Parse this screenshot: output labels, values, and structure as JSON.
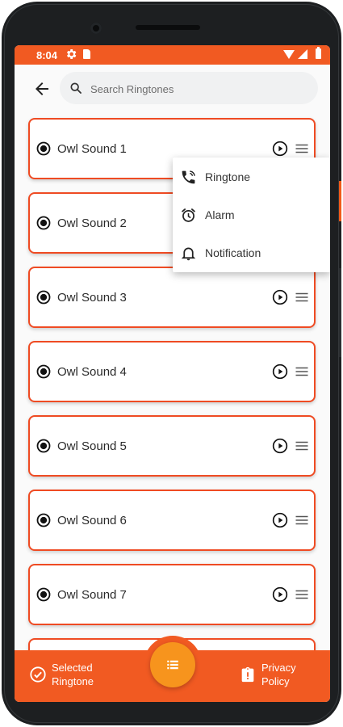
{
  "status_bar": {
    "time": "8:04",
    "icons": [
      "gear-icon",
      "sd-card-icon",
      "wifi-icon",
      "cell-signal-icon",
      "battery-icon"
    ]
  },
  "search": {
    "placeholder": "Search Ringtones",
    "value": ""
  },
  "ringtones": [
    {
      "label": "Owl Sound 1"
    },
    {
      "label": "Owl Sound 2"
    },
    {
      "label": "Owl Sound 3"
    },
    {
      "label": "Owl Sound 4"
    },
    {
      "label": "Owl Sound 5"
    },
    {
      "label": "Owl Sound 6"
    },
    {
      "label": "Owl Sound 7"
    }
  ],
  "popup_menu": {
    "items": [
      {
        "label": "Ringtone",
        "icon": "phone-ring-icon"
      },
      {
        "label": "Alarm",
        "icon": "alarm-clock-icon"
      },
      {
        "label": "Notification",
        "icon": "bell-icon"
      }
    ]
  },
  "bottom_bar": {
    "selected_label_line1": "Selected",
    "selected_label_line2": "Ringtone",
    "privacy_label_line1": "Privacy",
    "privacy_label_line2": "Policy",
    "fab_icon": "list-icon"
  },
  "colors": {
    "accent": "#f15a22",
    "item_border": "#ef4b23",
    "fab": "#f7941d"
  }
}
